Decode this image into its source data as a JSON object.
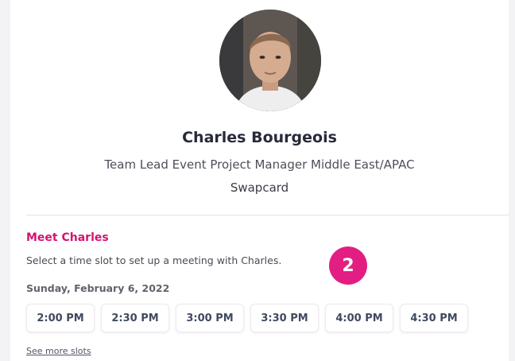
{
  "profile": {
    "avatar_icon": "user-photo",
    "name": "Charles Bourgeois",
    "role": "Team Lead Event Project Manager Middle East/APAC",
    "company": "Swapcard"
  },
  "meeting": {
    "title": "Meet Charles",
    "description": "Select a time slot to set up a meeting with Charles.",
    "date": "Sunday, February 6, 2022",
    "slots": [
      "2:00 PM",
      "2:30 PM",
      "3:00 PM",
      "3:30 PM",
      "4:00 PM",
      "4:30 PM"
    ],
    "see_more": "See more slots"
  },
  "badge": {
    "label": "2",
    "color": "#e31e82"
  },
  "colors": {
    "accent": "#d4136f",
    "title": "#272a3a"
  }
}
